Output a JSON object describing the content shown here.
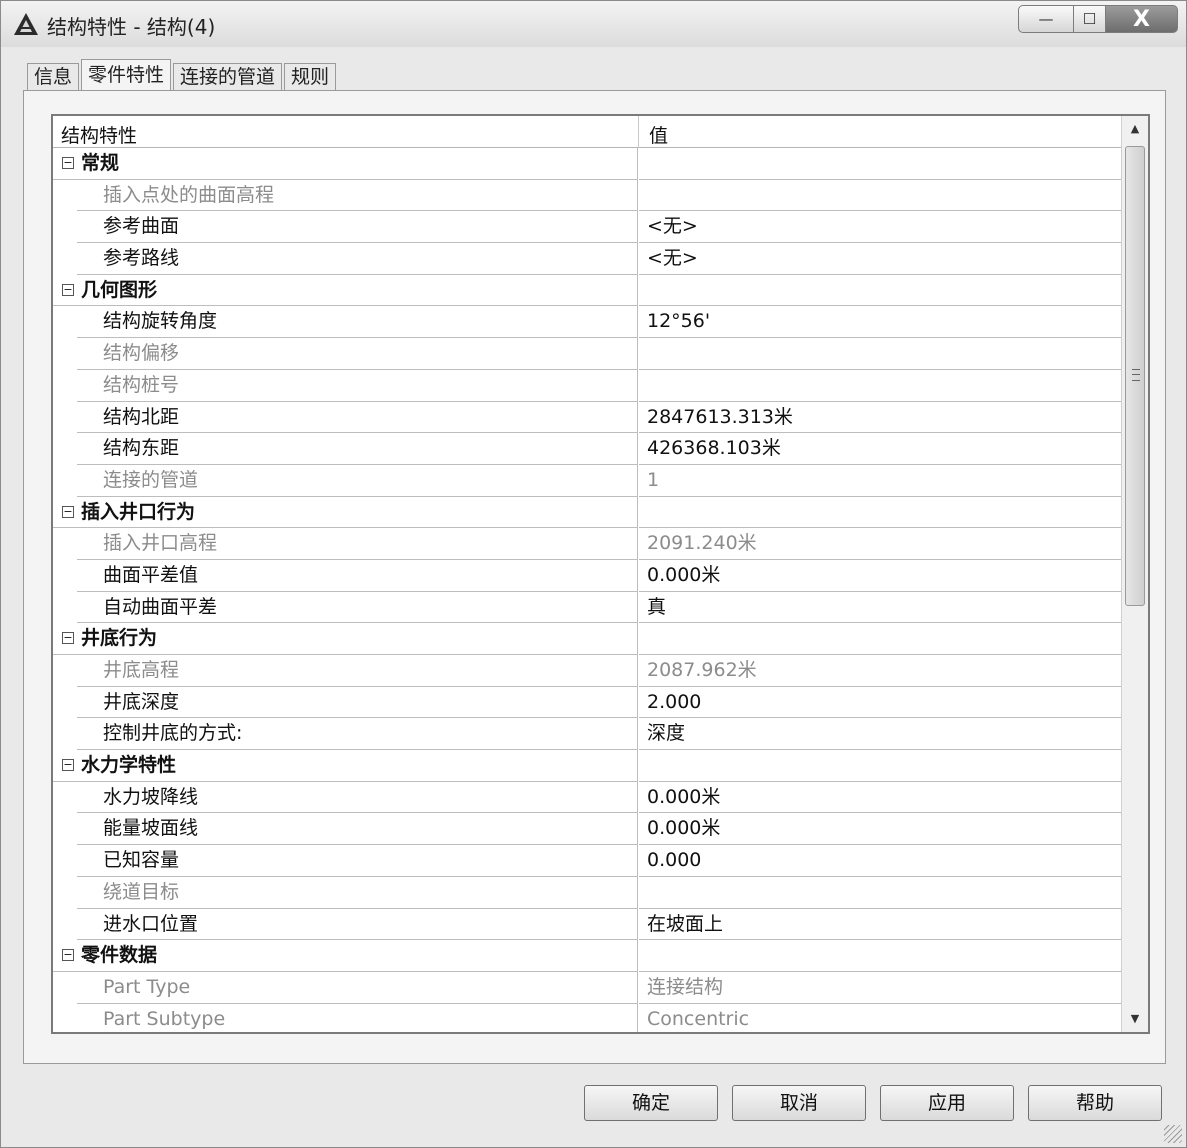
{
  "window": {
    "title": "结构特性 - 结构(4)",
    "minimize_glyph": "—",
    "maximize_glyph": "☐",
    "close_glyph": "X"
  },
  "tabs": [
    {
      "label": "信息",
      "active": false
    },
    {
      "label": "零件特性",
      "active": true
    },
    {
      "label": "连接的管道",
      "active": false
    },
    {
      "label": "规则",
      "active": false
    }
  ],
  "grid": {
    "header_name": "结构特性",
    "header_value": "值",
    "rows": [
      {
        "type": "cat",
        "name": "常规",
        "value": ""
      },
      {
        "type": "ro",
        "name": "插入点处的曲面高程",
        "value": ""
      },
      {
        "type": "prop",
        "name": "参考曲面",
        "value": "<无>"
      },
      {
        "type": "prop",
        "name": "参考路线",
        "value": "<无>"
      },
      {
        "type": "cat",
        "name": "几何图形",
        "value": ""
      },
      {
        "type": "prop",
        "name": "结构旋转角度",
        "value": "12°56'"
      },
      {
        "type": "ro",
        "name": "结构偏移",
        "value": ""
      },
      {
        "type": "ro",
        "name": "结构桩号",
        "value": ""
      },
      {
        "type": "prop",
        "name": "结构北距",
        "value": "2847613.313米"
      },
      {
        "type": "prop",
        "name": "结构东距",
        "value": "426368.103米"
      },
      {
        "type": "ro",
        "name": "连接的管道",
        "value": "1"
      },
      {
        "type": "cat",
        "name": "插入井口行为",
        "value": ""
      },
      {
        "type": "ro",
        "name": "插入井口高程",
        "value": "2091.240米"
      },
      {
        "type": "prop",
        "name": "曲面平差值",
        "value": "0.000米"
      },
      {
        "type": "prop",
        "name": "自动曲面平差",
        "value": "真"
      },
      {
        "type": "cat",
        "name": "井底行为",
        "value": ""
      },
      {
        "type": "ro",
        "name": "井底高程",
        "value": "2087.962米"
      },
      {
        "type": "prop",
        "name": "井底深度",
        "value": "2.000"
      },
      {
        "type": "prop",
        "name": "控制井底的方式:",
        "value": "深度"
      },
      {
        "type": "cat",
        "name": "水力学特性",
        "value": ""
      },
      {
        "type": "prop",
        "name": "水力坡降线",
        "value": "0.000米"
      },
      {
        "type": "prop",
        "name": "能量坡面线",
        "value": "0.000米"
      },
      {
        "type": "prop",
        "name": "已知容量",
        "value": "0.000"
      },
      {
        "type": "ro",
        "name": "绕道目标",
        "value": ""
      },
      {
        "type": "prop",
        "name": "进水口位置",
        "value": "在坡面上"
      },
      {
        "type": "cat",
        "name": "零件数据",
        "value": ""
      },
      {
        "type": "ro",
        "name": "Part Type",
        "value": "连接结构"
      },
      {
        "type": "ro",
        "name": "Part Subtype",
        "value": "Concentric"
      }
    ]
  },
  "buttons": {
    "ok": "确定",
    "cancel": "取消",
    "apply": "应用",
    "help": "帮助"
  },
  "scrollbar": {
    "up_glyph": "▲",
    "down_glyph": "▼"
  },
  "tree_toggle_glyph": "−"
}
